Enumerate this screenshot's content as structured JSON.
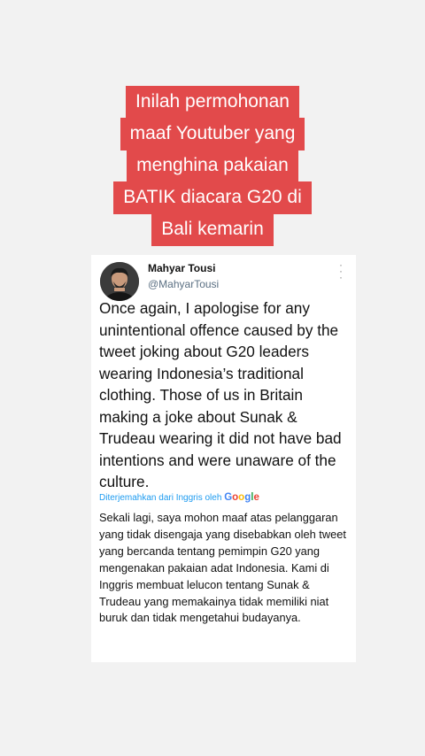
{
  "caption": {
    "lines": [
      "Inilah permohonan",
      "maaf Youtuber yang",
      "menghina pakaian",
      "BATIK diacara G20 di",
      "Bali kemarin"
    ]
  },
  "tweet": {
    "author_name": "Mahyar Tousi",
    "author_handle": "@MahyarTousi",
    "more_icon": "more-vertical-icon",
    "text": "Once again, I apologise for any unintentional offence caused by the tweet joking about G20 leaders wearing Indonesia’s traditional clothing. Those of us in Britain making a joke about Sunak & Trudeau wearing it did not have bad intentions and were unaware of the culture.",
    "translated_by": "Diterjemahkan dari Inggris oleh",
    "translator_logo": "Google",
    "translation": "Sekali lagi, saya mohon maaf atas pelanggaran yang tidak disengaja yang disebabkan oleh tweet yang bercanda tentang pemimpin G20 yang mengenakan pakaian adat Indonesia. Kami di Inggris membuat lelucon tentang Sunak & Trudeau yang memakainya tidak memiliki niat buruk dan tidak mengetahui budayanya."
  },
  "colors": {
    "caption_bg": "#e24a4b",
    "link_blue": "#1d9bf0",
    "handle_gray": "#5b7083"
  }
}
